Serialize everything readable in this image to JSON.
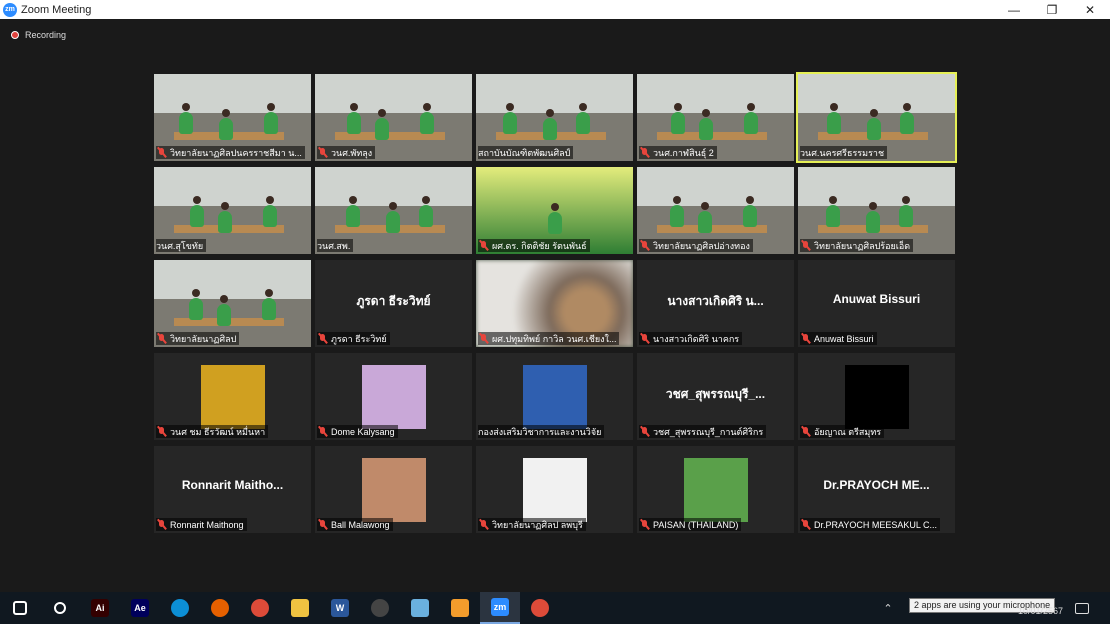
{
  "window": {
    "title": "Zoom Meeting",
    "minimize_label": "—",
    "restore_label": "❐",
    "close_label": "✕"
  },
  "status": {
    "recording_label": "Recording"
  },
  "tiles": [
    {
      "name": "วิทยาลัยนาฏศิลปนครราชสีมา น...",
      "type": "video",
      "muted": true
    },
    {
      "name": "วนศ.พัทลุง",
      "type": "video",
      "muted": true
    },
    {
      "name": "สถาบันบัณฑิตพัฒนศิลป์",
      "type": "video",
      "muted": false
    },
    {
      "name": "วนศ.กาฬสินธุ์ 2",
      "type": "video",
      "muted": true
    },
    {
      "name": "วนศ.นครศรีธรรมราช",
      "type": "video",
      "muted": false,
      "active": true
    },
    {
      "name": "วนศ.สุโขทัย",
      "type": "video",
      "muted": false
    },
    {
      "name": "วนศ.สพ.",
      "type": "video",
      "muted": false
    },
    {
      "name": "ผศ.ดร. กิตติชัย รัตนพันธ์",
      "type": "banner",
      "muted": true
    },
    {
      "name": "วิทยาลัยนาฏศิลปอ่างทอง",
      "type": "video",
      "muted": true
    },
    {
      "name": "วิทยาลัยนาฏศิลปร้อยเอ็ด",
      "type": "video",
      "muted": true
    },
    {
      "name": "วิทยาลัยนาฏศิลป",
      "type": "video",
      "muted": true
    },
    {
      "name": "ภูรดา ธีระวิทย์",
      "display": "ภูรดา ธีระวิทย์",
      "type": "name",
      "muted": true
    },
    {
      "name": "ผศ.ปทุมทิพย์ กาวิล วนศ.เชียงใ...",
      "type": "blur",
      "muted": true
    },
    {
      "name": "นางสาวเกิดศิริ นาคกร",
      "display": "นางสาวเกิดศิริ น...",
      "type": "name",
      "muted": true
    },
    {
      "name": "Anuwat Bissuri",
      "display": "Anuwat Bissuri",
      "type": "name",
      "muted": true
    },
    {
      "name": "วนศ ชม ธีรวัฒน์ หมื่นหา",
      "type": "avatar",
      "avatar_color": "#d0a020",
      "muted": true
    },
    {
      "name": "Dome Kalysang",
      "type": "avatar",
      "avatar_color": "#c9a8d8",
      "muted": true
    },
    {
      "name": "กองส่งเสริมวิชาการและงานวิจัย",
      "type": "avatar",
      "avatar_color": "#2f5fb0",
      "muted": false
    },
    {
      "name": "วชศ_สุพรรณบุรี_กานต์ศิริกร",
      "display": "วชศ_สุพรรณบุรี_...",
      "type": "name",
      "muted": true
    },
    {
      "name": "อัยญาณ ตรีสมุทร",
      "type": "avatar",
      "avatar_color": "#000000",
      "muted": true
    },
    {
      "name": "Ronnarit Maithong",
      "display": "Ronnarit Maitho...",
      "type": "name",
      "muted": true
    },
    {
      "name": "Ball Malawong",
      "type": "avatar",
      "avatar_color": "#c08a6a",
      "muted": true
    },
    {
      "name": "วิทยาลัยนาฏศิลป ลพบุรี",
      "type": "avatar",
      "avatar_color": "#f1f1f1",
      "muted": true
    },
    {
      "name": "PAISAN (THAILAND)",
      "type": "avatar",
      "avatar_color": "#5aa04a",
      "muted": true
    },
    {
      "name": "Dr.PRAYOCH MEESAKUL C...",
      "display": "Dr.PRAYOCH ME...",
      "type": "name",
      "muted": true
    }
  ],
  "taskbar": {
    "items": [
      {
        "name": "start",
        "label": "",
        "color": "#ffffff"
      },
      {
        "name": "search",
        "label": "",
        "color": "#ffffff"
      },
      {
        "name": "illustrator",
        "label": "Ai",
        "color": "#330000"
      },
      {
        "name": "after-effects",
        "label": "Ae",
        "color": "#00005b"
      },
      {
        "name": "edge",
        "label": "",
        "color": "#0c8fd6"
      },
      {
        "name": "firefox",
        "label": "",
        "color": "#e66000"
      },
      {
        "name": "chrome",
        "label": "",
        "color": "#dd4b39"
      },
      {
        "name": "file-explorer",
        "label": "",
        "color": "#f0c341"
      },
      {
        "name": "word",
        "label": "W",
        "color": "#2b579a"
      },
      {
        "name": "app-circle",
        "label": "",
        "color": "#444444"
      },
      {
        "name": "app-blue",
        "label": "",
        "color": "#6ab0de"
      },
      {
        "name": "media",
        "label": "",
        "color": "#f39c2c"
      },
      {
        "name": "zoom",
        "label": "zm",
        "color": "#2D8CFF",
        "active": true
      },
      {
        "name": "chrome-alt",
        "label": "",
        "color": "#dd4b39"
      }
    ],
    "mic_tooltip": "2 apps are using your microphone",
    "date": "10/01/2567"
  }
}
